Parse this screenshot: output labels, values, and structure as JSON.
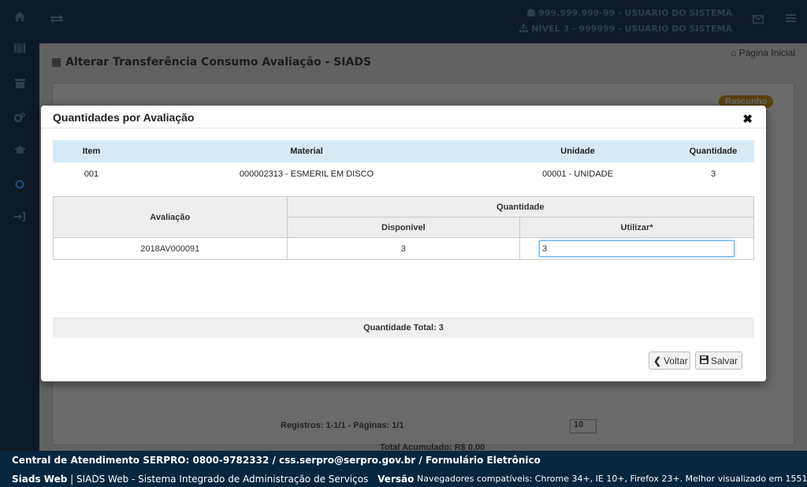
{
  "header": {
    "user_line1": "999.999.999-99 - USUARIO DO SISTEMA",
    "user_line2": "NÍVEL 3 - 999999 - USUARIO DO SISTEMA"
  },
  "sidebar": {
    "icons": [
      "home-icon",
      "barcode-icon",
      "archive-icon",
      "cogs-icon",
      "graduation-cap-icon",
      "circle-icon",
      "sign-in-icon"
    ]
  },
  "page": {
    "title": "Alterar Transferência Consumo Avaliação - SIADS",
    "home_link": "Página Inicial",
    "status_badge": "Rascunho",
    "pagination_text": "Registros: 1-1/1 - Páginas: 1/1",
    "page_size": "10",
    "total_acumulado": "Total Acumulado: R$ 0,00"
  },
  "modal": {
    "title": "Quantidades por Avaliação",
    "item_table": {
      "headers": [
        "Item",
        "Material",
        "Unidade",
        "Quantidade"
      ],
      "row": [
        "001",
        "000002313 - ESMERIL EM DISCO",
        "00001 - UNIDADE",
        "3"
      ]
    },
    "aval_table": {
      "header_avaliacao": "Avaliação",
      "header_quantidade": "Quantidade",
      "header_disponivel": "Disponível",
      "header_utilizar": "Utilizar*",
      "rows": [
        {
          "avaliacao": "2018AV000091",
          "disponivel": "3",
          "utilizar": "3"
        }
      ]
    },
    "total_label": "Quantidade Total: 3",
    "back_label": "Voltar",
    "save_label": "Salvar"
  },
  "footer": {
    "line1": "Central de Atendimento SERPRO: 0800-9782332 / css.serpro@serpro.gov.br / Formulário Eletrônico",
    "brand": "Siads Web",
    "system_name": "SIADS Web - Sistema Integrado de Administração de Serviços",
    "version_label": "Versão",
    "browsers": "Navegadores compatíveis: Chrome 34+, IE 10+, Firefox 23+. Melhor visualizado em 1551x876."
  },
  "colors": {
    "dark_nav": "#0e1a26",
    "footer_bg": "#062640",
    "table_header_blue": "#d6eaf5",
    "badge": "#d08a00"
  }
}
